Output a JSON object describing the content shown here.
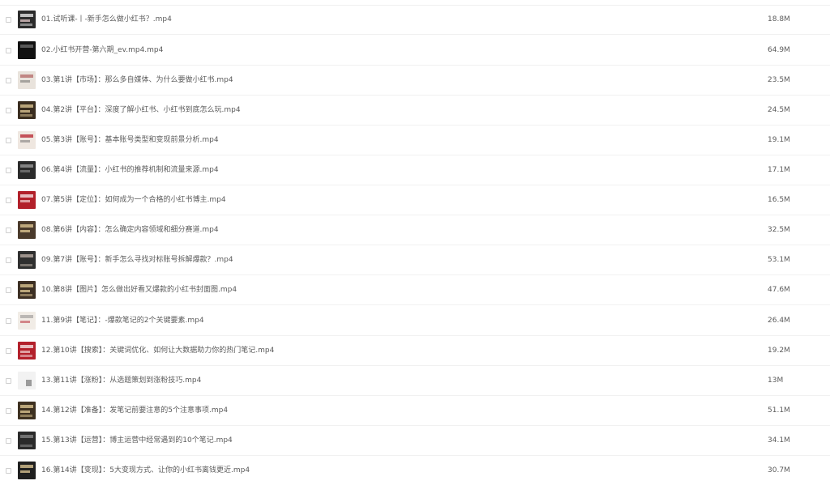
{
  "files": [
    {
      "name": "01.试听课-丨-新手怎么做小红书？.mp4",
      "size": "18.8M",
      "thumb_color": "#2b2b2b"
    },
    {
      "name": "02.小红书开营-第六期_ev.mp4.mp4",
      "size": "64.9M",
      "thumb_color": "#111111"
    },
    {
      "name": "03.第1讲【市场】：那么多自媒体、为什么要做小红书.mp4",
      "size": "23.5M",
      "thumb_color": "#e9e3dc"
    },
    {
      "name": "04.第2讲【平台】：深度了解小红书、小红书到底怎么玩.mp4",
      "size": "24.5M",
      "thumb_color": "#3a2d1f"
    },
    {
      "name": "05.第3讲【账号】：基本账号类型和变现前景分析.mp4",
      "size": "19.1M",
      "thumb_color": "#efe7e0"
    },
    {
      "name": "06.第4讲【流量】：小红书的推荐机制和流量来源.mp4",
      "size": "17.1M",
      "thumb_color": "#2b2b2b"
    },
    {
      "name": "07.第5讲【定位】：如何成为一个合格的小红书博主.mp4",
      "size": "16.5M",
      "thumb_color": "#b2202a"
    },
    {
      "name": "08.第6讲【内容】：怎么确定内容领域和细分赛道.mp4",
      "size": "32.5M",
      "thumb_color": "#4a3a2b"
    },
    {
      "name": "09.第7讲【账号】：新手怎么寻找对标账号拆解爆款？.mp4",
      "size": "53.1M",
      "thumb_color": "#2f2f2f"
    },
    {
      "name": "10.第8讲【图片】怎么做出好看又爆款的小红书封面图.mp4",
      "size": "47.6M",
      "thumb_color": "#3c2f23"
    },
    {
      "name": "11.第9讲【笔记】：-爆款笔记的2个关键要素.mp4",
      "size": "26.4M",
      "thumb_color": "#f1ece6"
    },
    {
      "name": "12.第10讲【搜索】：关键词优化、如何让大数据助力你的热门笔记.mp4",
      "size": "19.2M",
      "thumb_color": "#b3202b"
    },
    {
      "name": "13.第11讲【涨粉】：从选题策划到涨粉技巧.mp4",
      "size": "13M",
      "thumb_color": "#f2f2f2"
    },
    {
      "name": "14.第12讲【准备】：发笔记前要注意的5个注意事项.mp4",
      "size": "51.1M",
      "thumb_color": "#3d3020"
    },
    {
      "name": "15.第13讲【运营】：博主运营中经常遇到的10个笔记.mp4",
      "size": "34.1M",
      "thumb_color": "#2a2a2a"
    },
    {
      "name": "16.第14讲【变现】：5大变现方式、让你的小红书离钱更近.mp4",
      "size": "30.7M",
      "thumb_color": "#1f1f1f"
    }
  ]
}
